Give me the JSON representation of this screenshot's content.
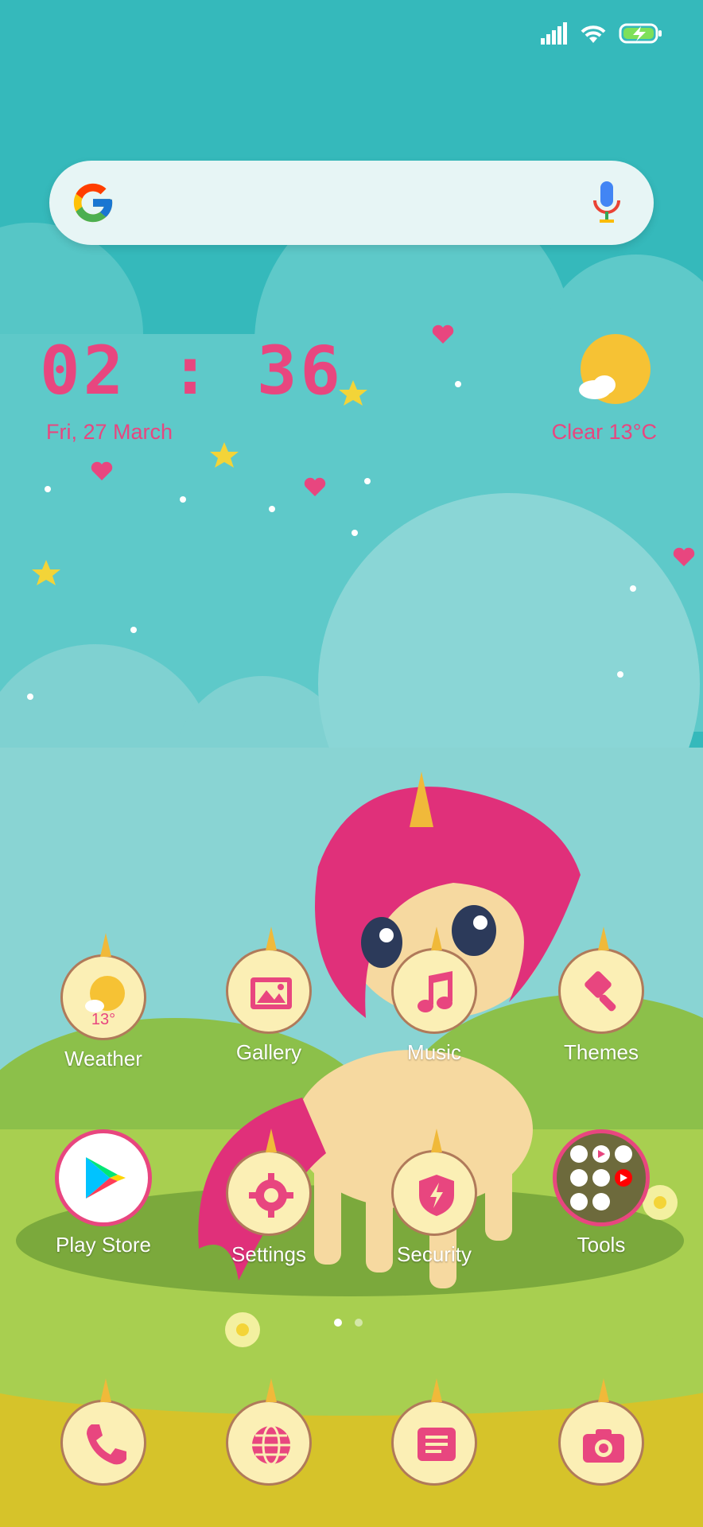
{
  "status_bar": {
    "signal_icon": "signal-icon",
    "wifi_icon": "wifi-icon",
    "battery_icon": "battery-charging-icon"
  },
  "search_bar": {
    "logo_icon": "google-logo-icon",
    "mic_icon": "mic-icon"
  },
  "clock_widget": {
    "time": "02 : 36",
    "date": "Fri, 27 March",
    "weather": "Clear  13°C",
    "weather_icon": "sunny-cloud-icon"
  },
  "apps_row1": [
    {
      "label": "Weather",
      "icon": "weather-icon",
      "temp": "13°"
    },
    {
      "label": "Gallery",
      "icon": "gallery-icon"
    },
    {
      "label": "Music",
      "icon": "music-icon"
    },
    {
      "label": "Themes",
      "icon": "themes-icon"
    }
  ],
  "apps_row2": [
    {
      "label": "Play Store",
      "icon": "play-store-icon"
    },
    {
      "label": "Settings",
      "icon": "settings-icon"
    },
    {
      "label": "Security",
      "icon": "security-icon"
    },
    {
      "label": "Tools",
      "icon": "tools-folder-icon"
    }
  ],
  "dock": [
    {
      "icon": "phone-icon"
    },
    {
      "icon": "browser-icon"
    },
    {
      "icon": "messages-icon"
    },
    {
      "icon": "camera-icon"
    }
  ],
  "page_indicator": {
    "pages": 2,
    "current": 1
  },
  "colors": {
    "accent": "#e8467f",
    "icon_bg": "#fbefb5",
    "sky": "#3dbdbf",
    "grass": "#9bc94b"
  }
}
